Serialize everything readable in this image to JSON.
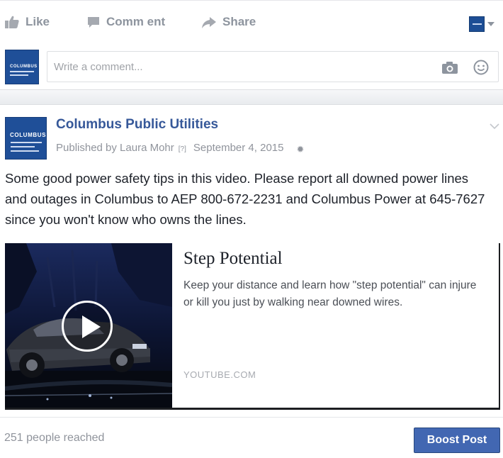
{
  "actions": {
    "like": "Like",
    "comment": "Comm ent",
    "share": "Share",
    "like_icon": "thumbs-up-icon",
    "comment_icon": "speech-bubble-icon",
    "share_icon": "share-arrow-icon"
  },
  "composer": {
    "placeholder": "Write a comment...",
    "camera_icon": "camera-icon",
    "emoji_icon": "smiley-icon"
  },
  "post": {
    "page_name": "Columbus Public Utilities",
    "published_by": "Published by Laura Mohr",
    "help_marker": "[?]",
    "date": "September 4, 2015",
    "text": "Some good power safety tips in this video. Please report all downed power lines and outages in Columbus to AEP 800-672-2231 and Columbus Power at 645-7627 since you won't know who owns the lines.",
    "link": {
      "title": "Step Potential",
      "description": "Keep your distance and learn how \"step potential\" can injure or kill you just by walking near downed wires.",
      "source": "YOUTUBE.COM"
    }
  },
  "footer": {
    "reach": "251 people reached",
    "boost_label": "Boost Post"
  },
  "colors": {
    "link_blue": "#365899",
    "boost_blue": "#4267b2",
    "muted_grey": "#90949c",
    "logo_navy": "#1f4f98"
  }
}
